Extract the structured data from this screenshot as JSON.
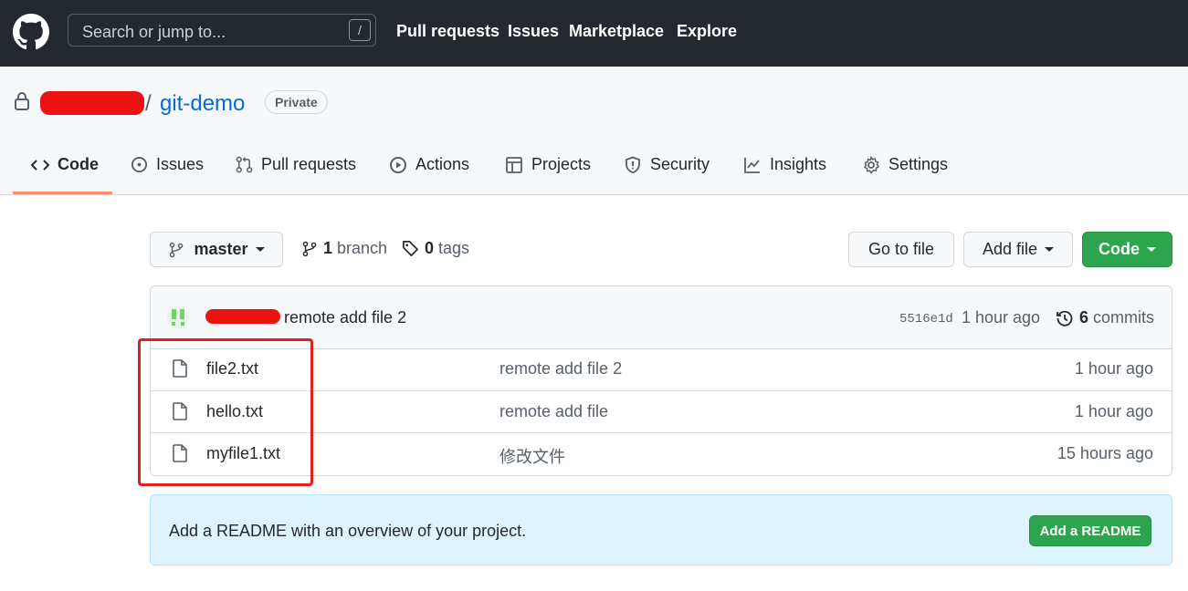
{
  "topbar": {
    "search_placeholder": "Search or jump to...",
    "search_shortcut": "/",
    "nav": [
      "Pull requests",
      "Issues",
      "Marketplace",
      "Explore"
    ]
  },
  "repo": {
    "name": "git-demo",
    "separator": "/",
    "visibility": "Private"
  },
  "tabs": [
    {
      "label": "Code",
      "icon": "code-icon"
    },
    {
      "label": "Issues",
      "icon": "issue-icon"
    },
    {
      "label": "Pull requests",
      "icon": "pull-request-icon"
    },
    {
      "label": "Actions",
      "icon": "play-icon"
    },
    {
      "label": "Projects",
      "icon": "table-icon"
    },
    {
      "label": "Security",
      "icon": "shield-icon"
    },
    {
      "label": "Insights",
      "icon": "graph-icon"
    },
    {
      "label": "Settings",
      "icon": "gear-icon"
    }
  ],
  "toolbar": {
    "branch": "master",
    "branch_count": "1",
    "branch_label": "branch",
    "tag_count": "0",
    "tag_label": "tags",
    "go_to_file": "Go to file",
    "add_file": "Add file",
    "code": "Code"
  },
  "commit": {
    "message": "remote add file 2",
    "sha": "5516e1d",
    "time": "1 hour ago",
    "commit_count": "6",
    "commit_label": "commits"
  },
  "files": [
    {
      "name": "file2.txt",
      "message": "remote add file 2",
      "time": "1 hour ago"
    },
    {
      "name": "hello.txt",
      "message": "remote add file",
      "time": "1 hour ago"
    },
    {
      "name": "myfile1.txt",
      "message": "修改文件",
      "time": "15 hours ago"
    }
  ],
  "readme": {
    "text": "Add a README with an overview of your project.",
    "button": "Add a README"
  },
  "colors": {
    "header_bg": "#24292f",
    "link_blue": "#0969da",
    "green": "#2da44e",
    "annotation_red": "#e02020",
    "readme_bg": "#ddf4ff"
  }
}
